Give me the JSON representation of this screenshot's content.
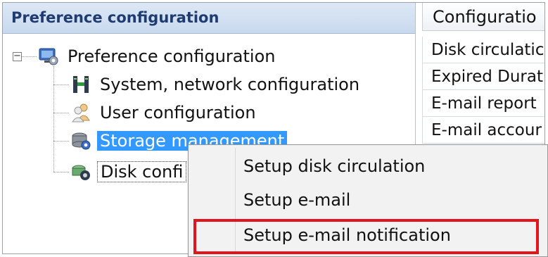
{
  "tree": {
    "header": "Preference configuration",
    "items": [
      {
        "label": "Preference configuration",
        "icon": "gear-computer-icon"
      },
      {
        "label": "System, network configuration",
        "icon": "network-icon"
      },
      {
        "label": "User configuration",
        "icon": "users-icon"
      },
      {
        "label": "Storage management",
        "icon": "storage-gear-icon"
      },
      {
        "label": "Disk confi",
        "icon": "disk-icon"
      }
    ],
    "expander_symbol": "−"
  },
  "list": {
    "header": "Configuratio",
    "rows": [
      "Disk circulatic",
      "Expired Durati",
      "E-mail report",
      "E-mail accour"
    ]
  },
  "context_menu": {
    "items": [
      "Setup disk circulation",
      "Setup e-mail",
      "Setup e-mail notification"
    ]
  },
  "colors": {
    "selection": "#3399ff",
    "header_text": "#1e3c72",
    "highlight_border": "#e3141c"
  }
}
